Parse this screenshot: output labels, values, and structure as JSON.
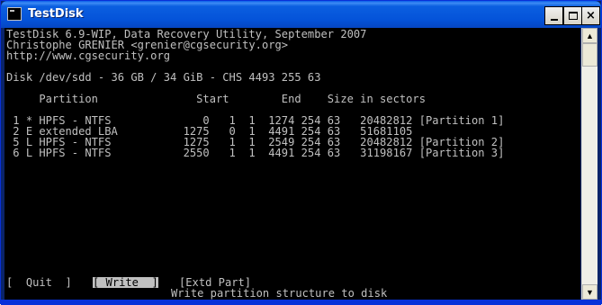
{
  "window": {
    "title": "TestDisk",
    "icon": "console-icon",
    "controls": {
      "minimize": "minimize-icon",
      "maximize": "maximize-icon",
      "close": "×"
    }
  },
  "console": {
    "header": [
      "TestDisk 6.9-WIP, Data Recovery Utility, September 2007",
      "Christophe GRENIER <grenier@cgsecurity.org>",
      "http://www.cgsecurity.org"
    ],
    "disk_line": "Disk /dev/sdd - 36 GB / 34 GiB - CHS 4493 255 63",
    "columns": "     Partition               Start        End    Size in sectors",
    "partitions": [
      " 1 * HPFS - NTFS              0   1  1  1274 254 63   20482812 [Partition 1]",
      " 2 E extended LBA          1275   0  1  4491 254 63   51681105",
      " 5 L HPFS - NTFS           1275   1  1  2549 254 63   20482812 [Partition 2]",
      " 6 L HPFS - NTFS           2550   1  1  4491 254 63   31198167 [Partition 3]"
    ],
    "menu": {
      "quit": "[  Quit  ]",
      "write": "[ Write  ]",
      "extd": "[Extd Part]"
    },
    "hint": "Write partition structure to disk"
  },
  "scrollbar": {
    "up": "▲",
    "down": "▼"
  }
}
